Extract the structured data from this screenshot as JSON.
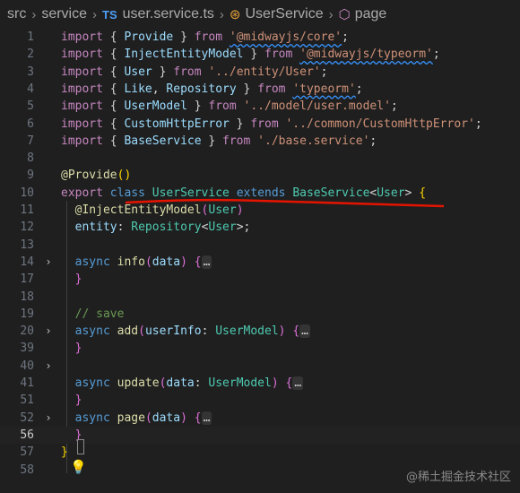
{
  "breadcrumb": {
    "items": [
      "src",
      "service",
      "user.service.ts",
      "UserService",
      "page"
    ],
    "ts_badge": "TS"
  },
  "code_lines": [
    {
      "n": "1",
      "tokens": [
        [
          "c",
          "import"
        ],
        [
          "p",
          " { "
        ],
        [
          "v",
          "Provide"
        ],
        [
          "p",
          " } "
        ],
        [
          "c",
          "from"
        ],
        [
          "p",
          " "
        ],
        [
          "s",
          "'@midwayjs/core'"
        ],
        [
          "p",
          ";"
        ]
      ]
    },
    {
      "n": "2",
      "tokens": [
        [
          "c",
          "import"
        ],
        [
          "p",
          " { "
        ],
        [
          "v",
          "InjectEntityModel"
        ],
        [
          "p",
          " } "
        ],
        [
          "c",
          "from"
        ],
        [
          "p",
          " "
        ],
        [
          "s",
          "'@midwayjs/typeorm'"
        ],
        [
          "p",
          ";"
        ]
      ]
    },
    {
      "n": "3",
      "tokens": [
        [
          "c",
          "import"
        ],
        [
          "p",
          " { "
        ],
        [
          "v",
          "User"
        ],
        [
          "p",
          " } "
        ],
        [
          "c",
          "from"
        ],
        [
          "p",
          " "
        ],
        [
          "s",
          "'../entity/User'"
        ],
        [
          "p",
          ";"
        ]
      ]
    },
    {
      "n": "4",
      "tokens": [
        [
          "c",
          "import"
        ],
        [
          "p",
          " { "
        ],
        [
          "v",
          "Like"
        ],
        [
          "p",
          ", "
        ],
        [
          "v",
          "Repository"
        ],
        [
          "p",
          " } "
        ],
        [
          "c",
          "from"
        ],
        [
          "p",
          " "
        ],
        [
          "s",
          "'typeorm'"
        ],
        [
          "p",
          ";"
        ]
      ]
    },
    {
      "n": "5",
      "tokens": [
        [
          "c",
          "import"
        ],
        [
          "p",
          " { "
        ],
        [
          "v",
          "UserModel"
        ],
        [
          "p",
          " } "
        ],
        [
          "c",
          "from"
        ],
        [
          "p",
          " "
        ],
        [
          "s",
          "'../model/user.model'"
        ],
        [
          "p",
          ";"
        ]
      ]
    },
    {
      "n": "6",
      "tokens": [
        [
          "c",
          "import"
        ],
        [
          "p",
          " { "
        ],
        [
          "v",
          "CustomHttpError"
        ],
        [
          "p",
          " } "
        ],
        [
          "c",
          "from"
        ],
        [
          "p",
          " "
        ],
        [
          "s",
          "'../common/CustomHttpError'"
        ],
        [
          "p",
          ";"
        ]
      ]
    },
    {
      "n": "7",
      "tokens": [
        [
          "c",
          "import"
        ],
        [
          "p",
          " { "
        ],
        [
          "v",
          "BaseService"
        ],
        [
          "p",
          " } "
        ],
        [
          "c",
          "from"
        ],
        [
          "p",
          " "
        ],
        [
          "s",
          "'./base.service'"
        ],
        [
          "p",
          ";"
        ]
      ]
    },
    {
      "n": "8",
      "tokens": []
    },
    {
      "n": "9",
      "tokens": [
        [
          "f",
          "@Provide"
        ],
        [
          "b1",
          "("
        ],
        [
          "b1",
          ")"
        ]
      ]
    },
    {
      "n": "10",
      "tokens": [
        [
          "c",
          "export"
        ],
        [
          "p",
          " "
        ],
        [
          "k",
          "class"
        ],
        [
          "p",
          " "
        ],
        [
          "t",
          "UserService"
        ],
        [
          "p",
          " "
        ],
        [
          "k",
          "extends"
        ],
        [
          "p",
          " "
        ],
        [
          "t",
          "BaseService"
        ],
        [
          "p",
          "<"
        ],
        [
          "t",
          "User"
        ],
        [
          "p",
          "> "
        ],
        [
          "b1",
          "{"
        ]
      ]
    },
    {
      "n": "11",
      "tokens": [
        [
          "p",
          "  "
        ],
        [
          "f",
          "@InjectEntityModel"
        ],
        [
          "b2",
          "("
        ],
        [
          "t",
          "User"
        ],
        [
          "b2",
          ")"
        ]
      ]
    },
    {
      "n": "12",
      "tokens": [
        [
          "p",
          "  "
        ],
        [
          "v",
          "entity"
        ],
        [
          "p",
          ": "
        ],
        [
          "t",
          "Repository"
        ],
        [
          "p",
          "<"
        ],
        [
          "t",
          "User"
        ],
        [
          "p",
          ">;"
        ]
      ]
    },
    {
      "n": "13",
      "tokens": []
    },
    {
      "n": "14",
      "fold": true,
      "tokens": [
        [
          "p",
          "  "
        ],
        [
          "k",
          "async"
        ],
        [
          "p",
          " "
        ],
        [
          "f",
          "info"
        ],
        [
          "b2",
          "("
        ],
        [
          "v",
          "data"
        ],
        [
          "b2",
          ")"
        ],
        [
          "p",
          " "
        ],
        [
          "b2",
          "{"
        ],
        [
          "fe",
          "…"
        ]
      ]
    },
    {
      "n": "17",
      "tokens": [
        [
          "p",
          "  "
        ],
        [
          "b2",
          "}"
        ]
      ]
    },
    {
      "n": "18",
      "tokens": []
    },
    {
      "n": "19",
      "tokens": [
        [
          "p",
          "  "
        ],
        [
          "cm",
          "// save"
        ]
      ]
    },
    {
      "n": "20",
      "fold": true,
      "tokens": [
        [
          "p",
          "  "
        ],
        [
          "k",
          "async"
        ],
        [
          "p",
          " "
        ],
        [
          "f",
          "add"
        ],
        [
          "b2",
          "("
        ],
        [
          "v",
          "userInfo"
        ],
        [
          "p",
          ": "
        ],
        [
          "t",
          "UserModel"
        ],
        [
          "b2",
          ")"
        ],
        [
          "p",
          " "
        ],
        [
          "b2",
          "{"
        ],
        [
          "fe",
          "…"
        ]
      ]
    },
    {
      "n": "39",
      "tokens": [
        [
          "p",
          "  "
        ],
        [
          "b2",
          "}"
        ]
      ]
    },
    {
      "n": "40",
      "fold": true,
      "tokens": []
    },
    {
      "n": "41",
      "tokens": [
        [
          "p",
          "  "
        ],
        [
          "k",
          "async"
        ],
        [
          "p",
          " "
        ],
        [
          "f",
          "update"
        ],
        [
          "b2",
          "("
        ],
        [
          "v",
          "data"
        ],
        [
          "p",
          ": "
        ],
        [
          "t",
          "UserModel"
        ],
        [
          "b2",
          ")"
        ],
        [
          "p",
          " "
        ],
        [
          "b2",
          "{"
        ],
        [
          "fe",
          "…"
        ]
      ]
    },
    {
      "n": "51",
      "tokens": [
        [
          "p",
          "  "
        ],
        [
          "b2",
          "}"
        ]
      ]
    },
    {
      "n": "52",
      "fold": true,
      "tokens": [
        [
          "p",
          "  "
        ],
        [
          "k",
          "async"
        ],
        [
          "p",
          " "
        ],
        [
          "f",
          "page"
        ],
        [
          "b2",
          "("
        ],
        [
          "v",
          "data"
        ],
        [
          "b2",
          ")"
        ],
        [
          "p",
          " "
        ],
        [
          "b2",
          "{"
        ],
        [
          "fe",
          "…"
        ]
      ]
    },
    {
      "n": "56",
      "tokens": [
        [
          "p",
          "  "
        ],
        [
          "b2",
          "}"
        ]
      ]
    },
    {
      "n": "57",
      "tokens": [
        [
          "b1",
          "}"
        ]
      ]
    },
    {
      "n": "58",
      "tokens": []
    }
  ],
  "watermark": "@稀土掘金技术社区",
  "colors": {
    "background": "#1f1f1f",
    "keyword": "#569cd6",
    "type": "#4ec9b0",
    "string": "#ce9178",
    "annotation_red": "#e51400"
  },
  "icons": [
    "chevron-right-icon",
    "class-icon",
    "cube-icon",
    "lightbulb-icon"
  ]
}
